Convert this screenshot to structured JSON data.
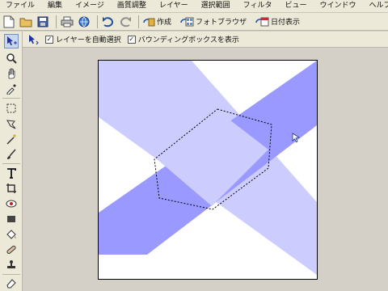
{
  "menu": {
    "items": [
      {
        "label": "ファイル"
      },
      {
        "label": "編集"
      },
      {
        "label": "イメージ"
      },
      {
        "label": "画質調整"
      },
      {
        "label": "レイヤー"
      },
      {
        "label": "選択範囲"
      },
      {
        "label": "フィルタ"
      },
      {
        "label": "ビュー"
      },
      {
        "label": "ウインドウ"
      },
      {
        "label": "ヘルプ"
      }
    ]
  },
  "toolbar": {
    "create_label": "作成",
    "photo_browser_label": "フォトブラウザ",
    "date_view_label": "日付表示"
  },
  "options": {
    "auto_select_label": "レイヤーを自動選択",
    "bounding_box_label": "バウンディングボックスを表示",
    "auto_select_checked": true,
    "bounding_box_checked": true
  },
  "canvas": {
    "background_color": "#ffffff",
    "light_band_color": "#ccccff",
    "dark_band_color": "#9999ff",
    "selection_shape": "hexagon"
  },
  "icons": {
    "move_tool": "move-icon",
    "zoom_tool": "magnifier-icon",
    "hand_tool": "hand-icon",
    "eyedropper_tool": "eyedropper-icon",
    "marquee_tool": "marquee-icon",
    "lasso_tool": "lasso-icon",
    "magic_wand_tool": "magic-wand-icon",
    "brush_tool": "brush-icon",
    "type_tool": "type-icon",
    "crop_tool": "crop-icon",
    "red_eye_tool": "red-eye-icon",
    "shape_tool": "shape-icon",
    "paint_bucket_tool": "paint-bucket-icon",
    "healing_tool": "healing-icon",
    "stamp_tool": "stamp-icon",
    "eraser_tool": "eraser-icon",
    "pencil_tool": "pencil-icon",
    "fill_tool": "fill-icon"
  }
}
